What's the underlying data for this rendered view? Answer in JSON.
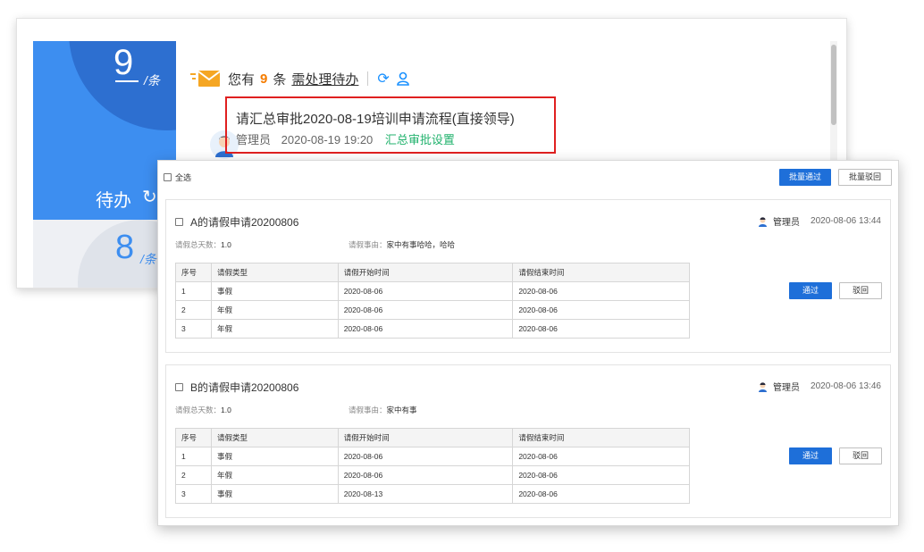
{
  "widget": {
    "pending_count": "9",
    "pending_unit": "/条",
    "pending_label": "待办",
    "other_count": "8",
    "other_unit": "/条",
    "notice_prefix": "您有",
    "notice_count": "9",
    "notice_mid": "条",
    "notice_link": "需处理待办",
    "task_title": "请汇总审批2020-08-19培训申请流程(直接领导)",
    "task_user": "管理员",
    "task_time": "2020-08-19 19:20",
    "task_action": "汇总审批设置"
  },
  "dialog": {
    "select_all": "全选",
    "batch_approve": "批量通过",
    "batch_reject": "批量驳回",
    "days_label": "请假总天数：",
    "reason_label": "请假事由：",
    "columns": [
      "序号",
      "请假类型",
      "请假开始时间",
      "请假结束时间"
    ],
    "approve": "通过",
    "reject": "驳回",
    "records": [
      {
        "title": "A的请假申请20200806",
        "user": "管理员",
        "time": "2020-08-06 13:44",
        "days": "1.0",
        "reason": "家中有事哈哈，哈哈",
        "rows": [
          [
            "1",
            "事假",
            "2020-08-06",
            "2020-08-06"
          ],
          [
            "2",
            "年假",
            "2020-08-06",
            "2020-08-06"
          ],
          [
            "3",
            "年假",
            "2020-08-06",
            "2020-08-06"
          ]
        ]
      },
      {
        "title": "B的请假申请20200806",
        "user": "管理员",
        "time": "2020-08-06 13:46",
        "days": "1.0",
        "reason": "家中有事",
        "rows": [
          [
            "1",
            "事假",
            "2020-08-06",
            "2020-08-06"
          ],
          [
            "2",
            "年假",
            "2020-08-06",
            "2020-08-06"
          ],
          [
            "3",
            "事假",
            "2020-08-13",
            "2020-08-06"
          ]
        ]
      }
    ]
  }
}
